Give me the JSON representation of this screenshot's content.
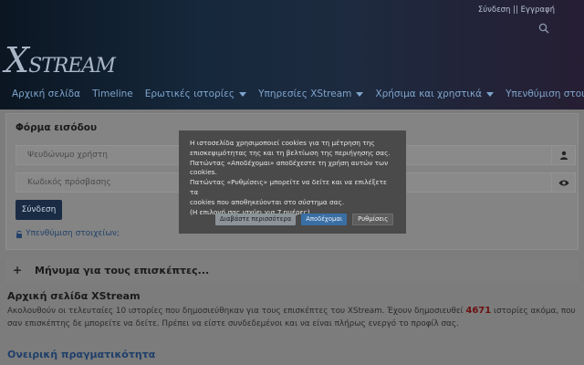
{
  "header": {
    "top_links": "Σύνδεση || Εγγραφή",
    "logo_x": "X",
    "logo_rest": "STREAM"
  },
  "nav": {
    "items": [
      {
        "label": "Αρχική σελίδα",
        "dropdown": false
      },
      {
        "label": "Timeline",
        "dropdown": false
      },
      {
        "label": "Ερωτικές ιστορίες",
        "dropdown": true
      },
      {
        "label": "Υπηρεσίες XStream",
        "dropdown": true
      },
      {
        "label": "Χρήσιμα και χρηστικά",
        "dropdown": true
      },
      {
        "label": "Υπενθύμιση στοιχείων",
        "dropdown": false
      }
    ]
  },
  "login_form": {
    "title": "Φόρμα εισόδου",
    "username_placeholder": "Ψευδώνυμο χρήστη",
    "password_placeholder": "Κωδικός πρόσβασης",
    "login_label": "Σύνδεση",
    "reminder_label": "Υπενθύμιση στοιχείων;"
  },
  "visitors": {
    "title": "Μήνυμα για τους επισκέπτες..."
  },
  "home": {
    "title": "Αρχική σελίδα XStream",
    "text_before": "Ακολουθούν οι τελευταίες 10 ιστορίες που δημοσιεύθηκαν για τους επισκέπτες του XStream. Έχουν δημοσιευθεί ",
    "count": "4671",
    "text_after": " ιστορίες ακόμα, που σαν επισκέπτης δε μπορείτε να δείτε. Πρέπει να είστε συνδεδεμένοι και να είναι πλήρως ενεργό το προφίλ σας."
  },
  "section": {
    "title": "Ονειρική πραγματικότητα"
  },
  "cookie": {
    "line1": "Η ιστοσελίδα χρησιμοποιεί cookies για τη μέτρηση της",
    "line2": "επισκεψιμότητας της και τη βελτίωση της περιήγησης σας.",
    "line3": "Πατώντας «Αποδέχομαι» αποδέχεστε τη χρήση αυτών των",
    "line4": "cookies.",
    "line5": "Πατώντας «Ρυθμίσεις» μπορείτε να δείτε και να επιλέξετε τα",
    "line6": "cookies που αποθηκεύονται στο σύστημα σας.",
    "line7": "(Η επιλογή σας ισχύει για 7 ημέρες)",
    "more_label": "Διαβάστε περισσότερα",
    "accept_label": "Αποδέχομαι",
    "settings_label": "Ρυθμίσεις"
  },
  "colors": {
    "accent": "#3a6fa5",
    "count": "#6b1010",
    "nav_text": "#7fa4cb"
  }
}
